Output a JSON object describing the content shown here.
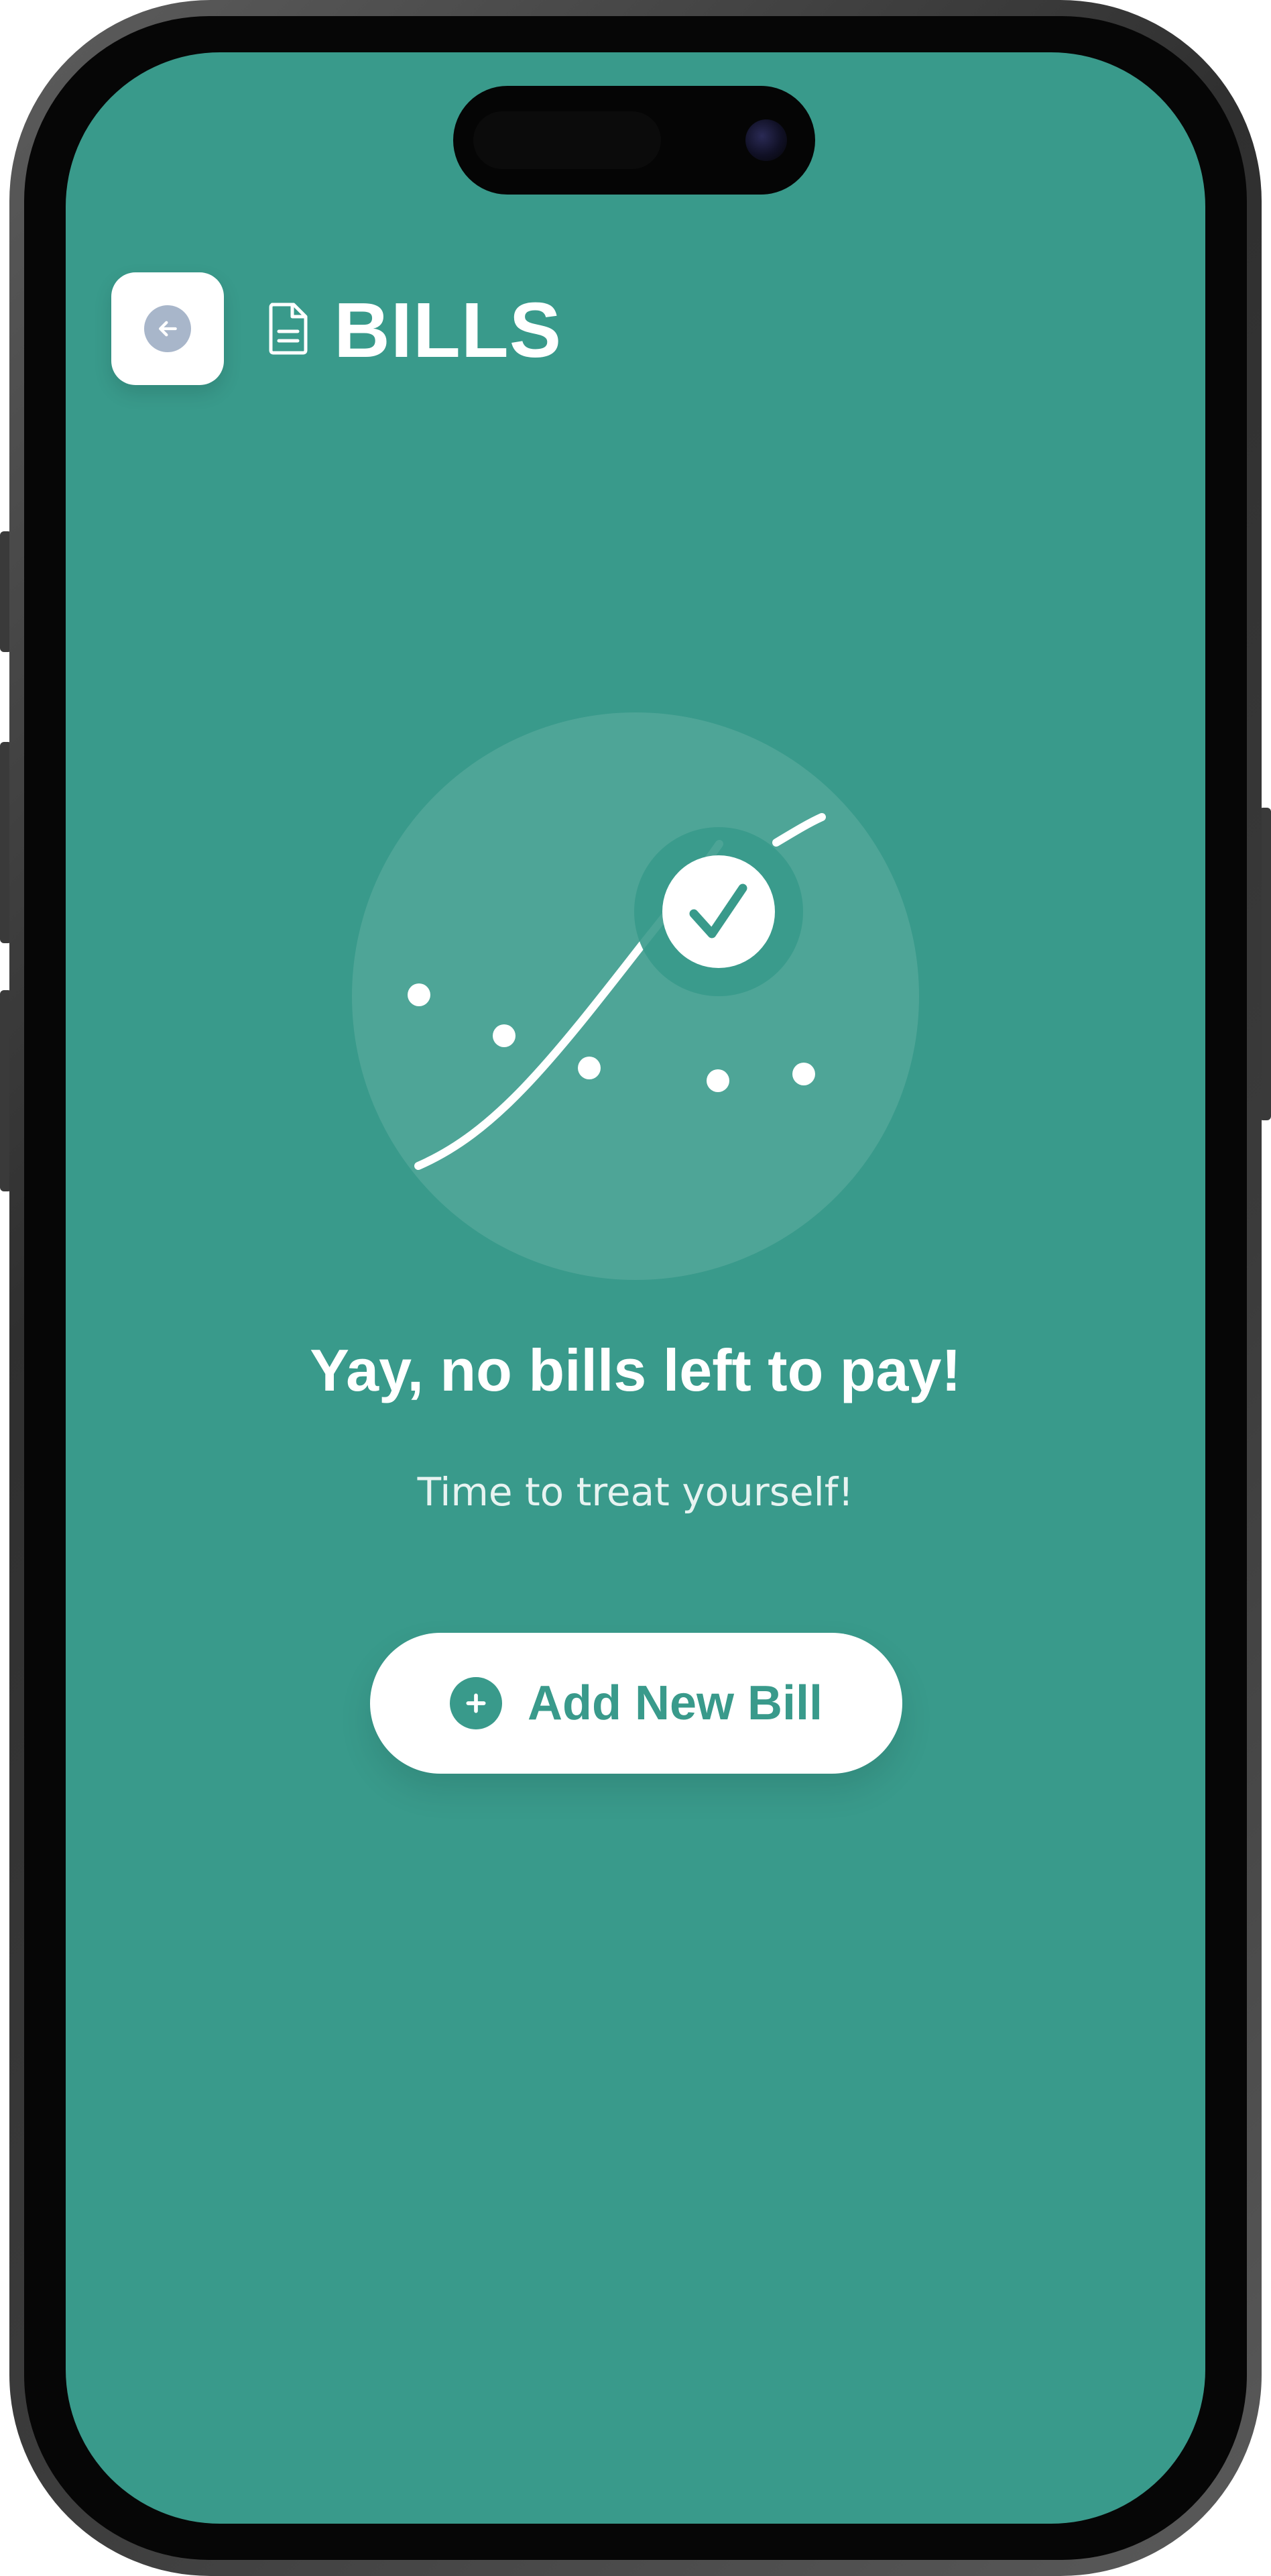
{
  "colors": {
    "accent": "#399a8b",
    "surface": "#ffffff",
    "back_icon": "#a8b6ca"
  },
  "header": {
    "back_icon": "arrow-left-icon",
    "title_icon": "document-icon",
    "title": "BILLS"
  },
  "empty_state": {
    "illustration_icon": "chart-check-icon",
    "headline": "Yay, no bills left to pay!",
    "subline": "Time to treat yourself!"
  },
  "add_button": {
    "icon": "plus-circle-icon",
    "label": "Add New Bill"
  }
}
